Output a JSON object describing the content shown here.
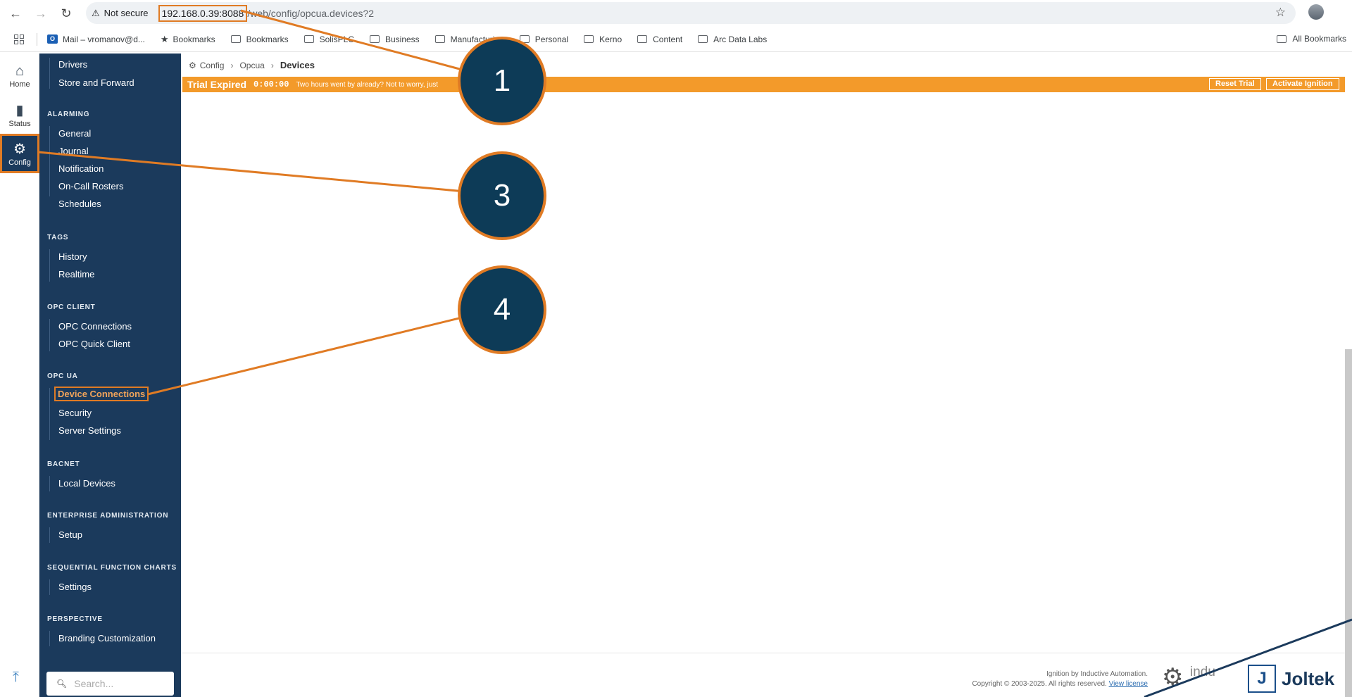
{
  "browser": {
    "security_label": "Not secure",
    "url_host": "192.168.0.39:8088",
    "url_path": "/web/config/opcua.devices?2",
    "bookmarks": [
      {
        "label": "Mail – vromanov@d...",
        "icon": "outlook-icon"
      },
      {
        "label": "Bookmarks",
        "icon": "star-icon"
      },
      {
        "label": "Bookmarks",
        "icon": "folder-icon"
      },
      {
        "label": "SolisPLC",
        "icon": "folder-icon"
      },
      {
        "label": "Business",
        "icon": "folder-icon"
      },
      {
        "label": "Manufacturing",
        "icon": "folder-icon"
      },
      {
        "label": "Personal",
        "icon": "folder-icon"
      },
      {
        "label": "Kerno",
        "icon": "folder-icon"
      },
      {
        "label": "Content",
        "icon": "folder-icon"
      },
      {
        "label": "Arc Data Labs",
        "icon": "folder-icon"
      }
    ],
    "all_bookmarks": "All Bookmarks"
  },
  "rail": {
    "home": "Home",
    "status": "Status",
    "config": "Config"
  },
  "sidebar": {
    "top_items": [
      "Drivers",
      "Store and Forward"
    ],
    "alarming": {
      "title": "ALARMING",
      "items": [
        "General",
        "Journal",
        "Notification",
        "On-Call Rosters",
        "Schedules"
      ]
    },
    "tags": {
      "title": "TAGS",
      "items": [
        "History",
        "Realtime"
      ]
    },
    "opc_client": {
      "title": "OPC CLIENT",
      "items": [
        "OPC Connections",
        "OPC Quick Client"
      ]
    },
    "opc_ua": {
      "title": "OPC UA",
      "items": [
        "Device Connections",
        "Security",
        "Server Settings"
      ]
    },
    "bacnet": {
      "title": "BACNET",
      "items": [
        "Local Devices"
      ]
    },
    "enterprise": {
      "title": "ENTERPRISE ADMINISTRATION",
      "items": [
        "Setup"
      ]
    },
    "sfc": {
      "title": "SEQUENTIAL FUNCTION CHARTS",
      "items": [
        "Settings"
      ]
    },
    "perspective": {
      "title": "PERSPECTIVE",
      "items": [
        "Branding Customization"
      ]
    },
    "search_placeholder": "Search..."
  },
  "breadcrumb": {
    "root": "Config",
    "middle": "Opcua",
    "current": "Devices"
  },
  "trial": {
    "title": "Trial Expired",
    "time": "0:00:00",
    "message": "Two hours went by already? Not to worry, just",
    "reset": "Reset Trial",
    "activate": "Activate Ignition"
  },
  "footer": {
    "line1": "Ignition by Inductive Automation.",
    "line2": "Copyright © 2003-2025. All rights reserved.",
    "license_link": "View license",
    "ia_text": "indu",
    "brand": "Joltek"
  },
  "markers": [
    "1",
    "3",
    "4"
  ],
  "colors": {
    "accent": "#e07b24",
    "sidebar": "#1b3a5c",
    "trial": "#f39a2a",
    "marker": "#0d3b57"
  }
}
